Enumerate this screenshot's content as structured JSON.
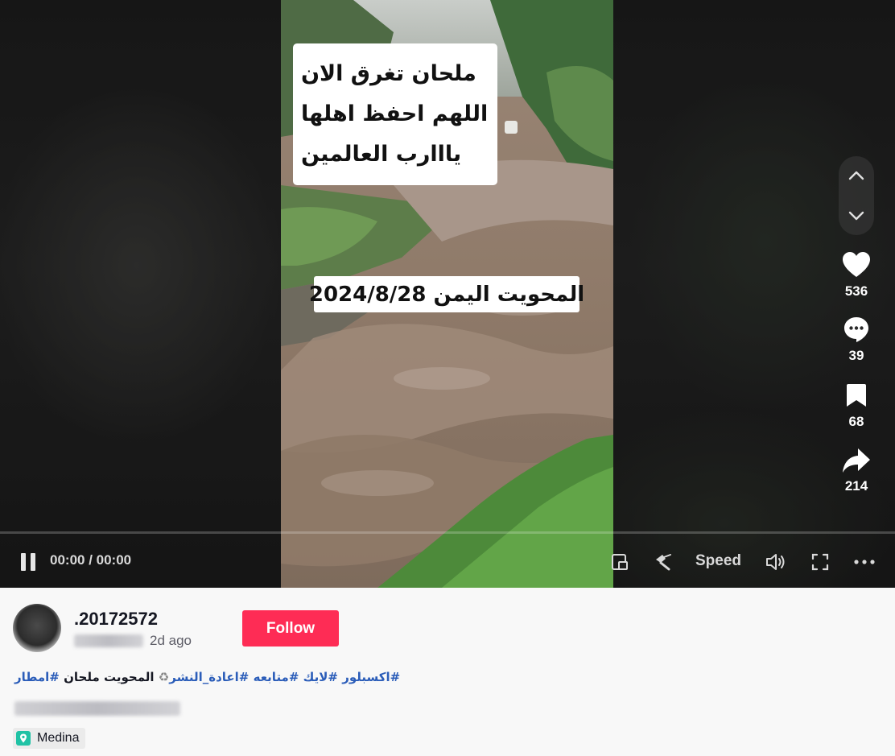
{
  "video": {
    "caption_lines": [
      "ملحان تغرق الان",
      "اللهم احفظ اهلها",
      "يااارب العالمين"
    ],
    "date_overlay": "المحويت اليمن 2024/8/28"
  },
  "actions": {
    "likes": "536",
    "comments": "39",
    "saves": "68",
    "shares": "214"
  },
  "controls": {
    "time": "00:00 / 00:00",
    "speed_label": "Speed",
    "progress": 0
  },
  "author": {
    "username": ".20172572",
    "posted": "2d ago",
    "follow_label": "Follow"
  },
  "description": {
    "hashtags": [
      "#اكسبلور",
      "#لايك",
      "#متابعه",
      "#اعادة_النشر"
    ],
    "recycle_glyph": "♻",
    "text_after": " المحويت ملحان ",
    "last_tag": "#امطار"
  },
  "location": {
    "label": "Medina",
    "icon": "location-pin-icon",
    "icon_color": "#20c2a5"
  },
  "colors": {
    "follow_button": "#fe2c55",
    "hashtag": "#2b5db9"
  }
}
